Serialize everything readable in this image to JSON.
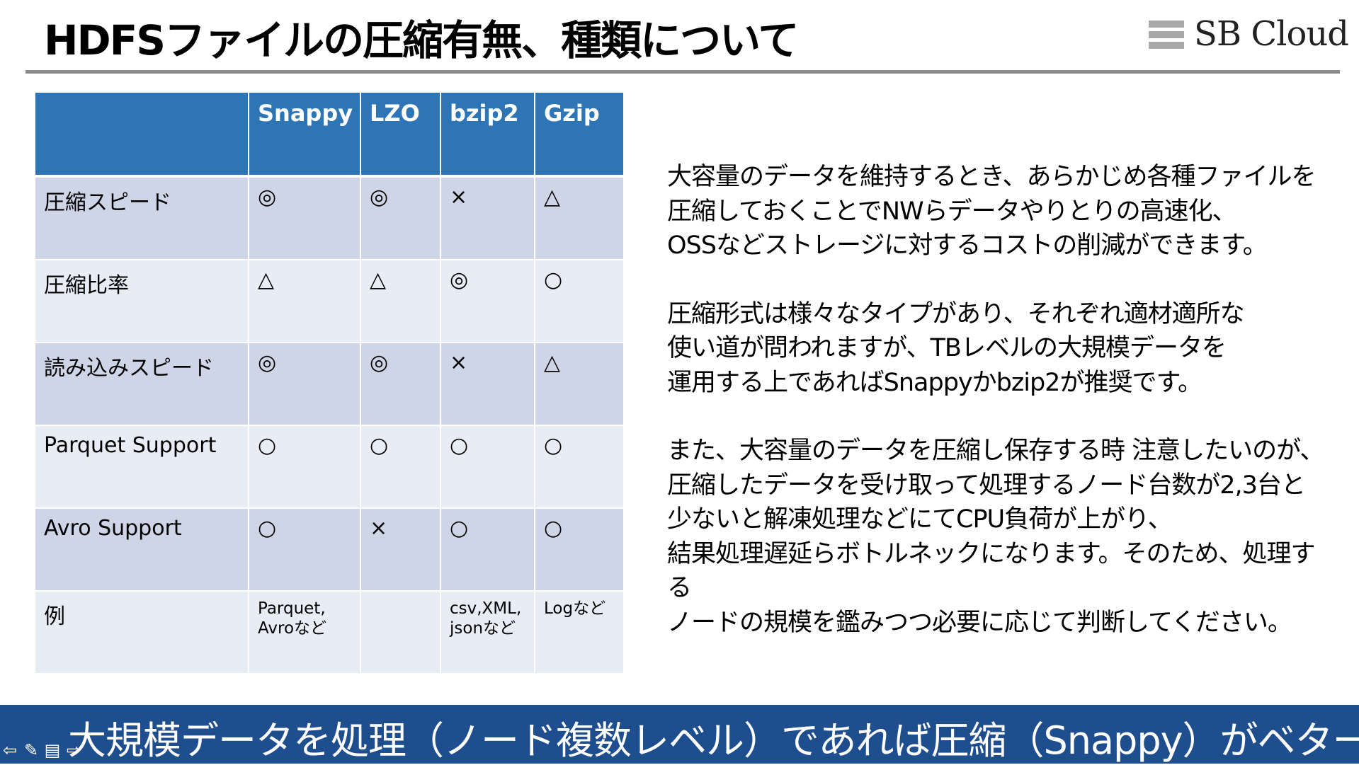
{
  "title": "HDFSファイルの圧縮有無、種類について",
  "logo": {
    "text": "SB Cloud"
  },
  "table": {
    "headers": [
      "",
      "Snappy",
      "LZO",
      "bzip2",
      "Gzip"
    ],
    "rows": [
      {
        "label": "圧縮スピード",
        "cells": [
          "◎",
          "◎",
          "×",
          "△"
        ]
      },
      {
        "label": "圧縮比率",
        "cells": [
          "△",
          "△",
          "◎",
          "○"
        ]
      },
      {
        "label": "読み込みスピード",
        "cells": [
          "◎",
          "◎",
          "×",
          "△"
        ]
      },
      {
        "label": "Parquet Support",
        "cells": [
          "○",
          "○",
          "○",
          "○"
        ]
      },
      {
        "label": "Avro Support",
        "cells": [
          "○",
          "×",
          "○",
          "○"
        ]
      },
      {
        "label": "例",
        "cells": [
          "Parquet,\nAvroなど",
          "",
          "csv,XML,\njsonなど",
          "Logなど"
        ]
      }
    ]
  },
  "description": {
    "p1": "大容量のデータを維持するとき、あらかじめ各種ファイルを\n圧縮しておくことでNWらデータやりとりの高速化、\nOSSなどストレージに対するコストの削減ができます。",
    "p2": "圧縮形式は様々なタイプがあり、それぞれ適材適所な\n使い道が問われますが、TBレベルの大規模データを\n運用する上であればSnappyかbzip2が推奨です。",
    "p3": "また、大容量のデータを圧縮し保存する時 注意したいのが、\n圧縮したデータを受け取って処理するノード台数が2,3台と\n少ないと解凍処理などにてCPU負荷が上がり、\n結果処理遅延らボトルネックになります。そのため、処理する\nノードの規模を鑑みつつ必要に応じて判断してください。"
  },
  "banner": "大規模データを処理（ノード複数レベル）であれば圧縮（Snappy）がベター",
  "nav": {
    "prev": "⇦",
    "pen": "✎",
    "menu": "▤",
    "next": "⇨"
  },
  "colors": {
    "header": "#2e75b6",
    "row_dark": "#cdd5e6",
    "row_light": "#e8ecf5",
    "banner": "#1f4e8e",
    "rule": "#8c8c8c"
  }
}
